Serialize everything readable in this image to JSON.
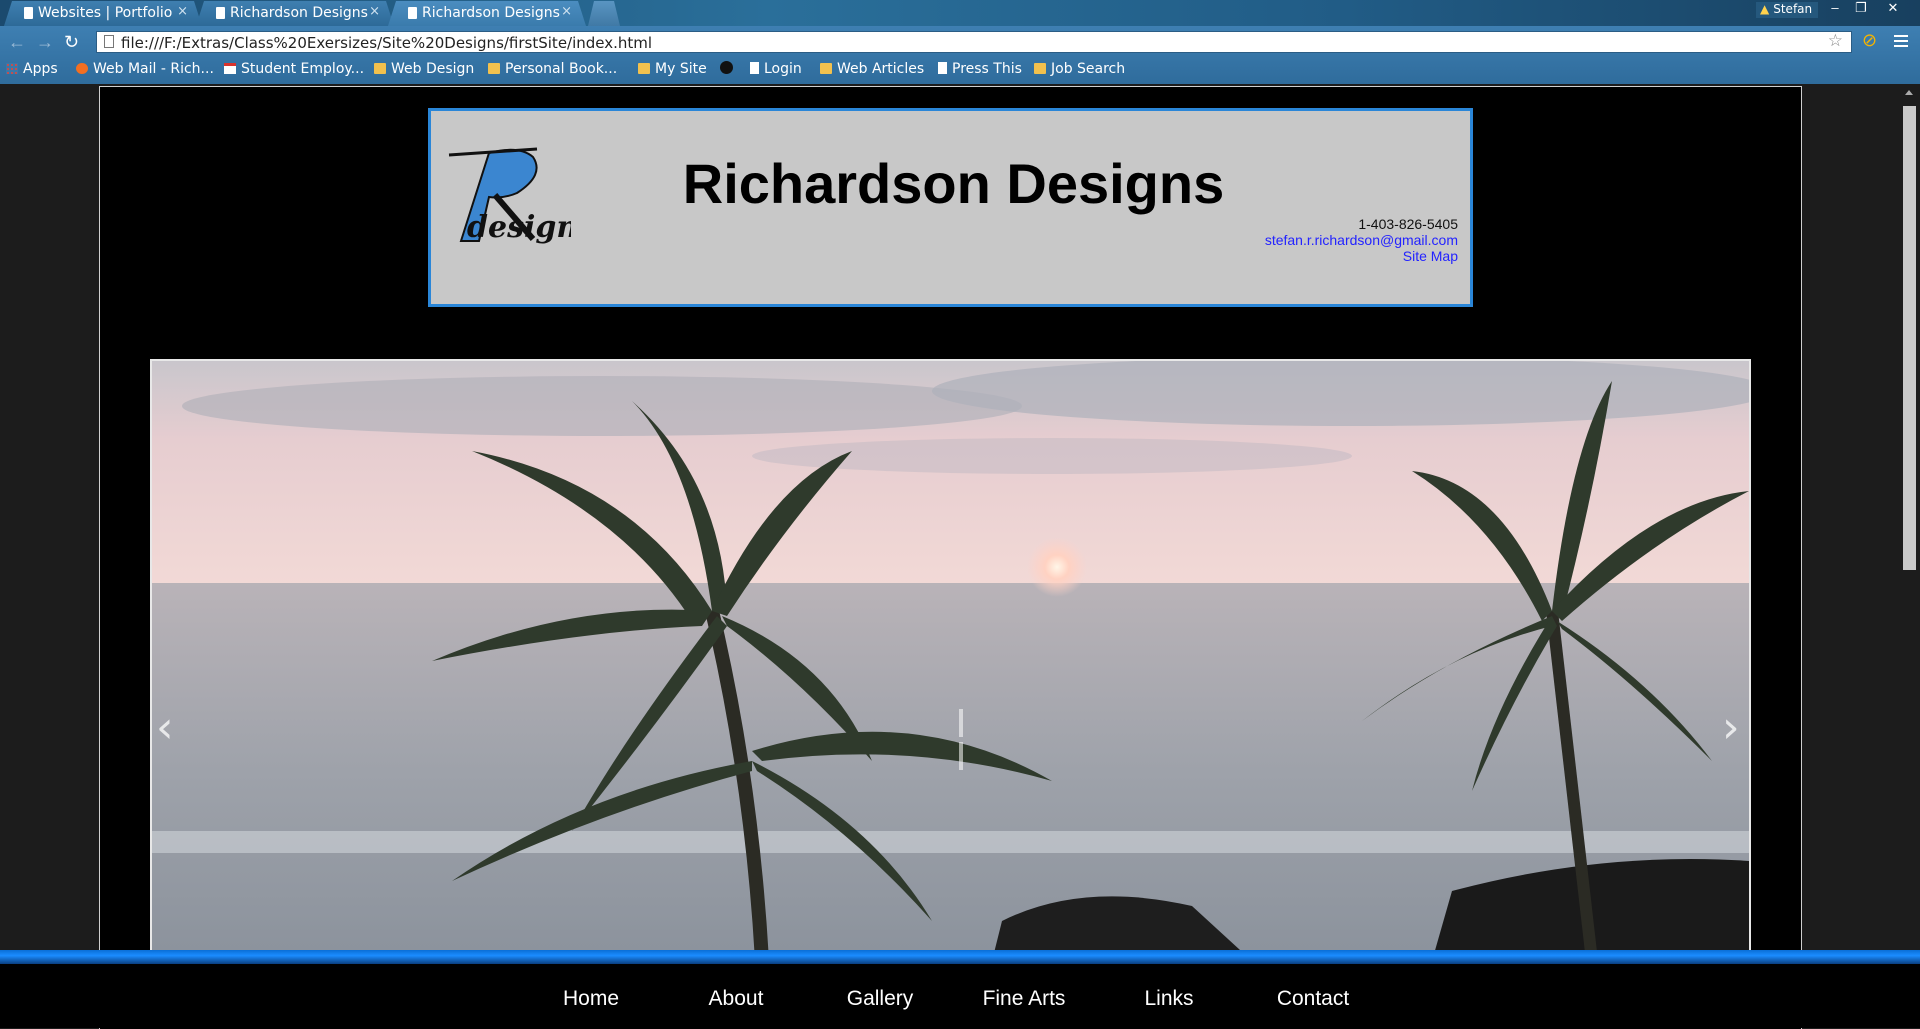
{
  "browser": {
    "tabs": [
      {
        "title": "Websites | Portfolio"
      },
      {
        "title": "Richardson Designs"
      },
      {
        "title": "Richardson Designs"
      }
    ],
    "profile_name": "Stefan",
    "window_controls": {
      "minimize": "–",
      "restore": "❐",
      "close": "✕"
    },
    "address": "file:///F:/Extras/Class%20Exersizes/Site%20Designs/firstSite/index.html",
    "bookmarks": [
      {
        "label": "Apps",
        "icon": "apps-icon"
      },
      {
        "label": "Web Mail - Rich...",
        "icon": "cpanel-icon"
      },
      {
        "label": "Student Employ...",
        "icon": "calendar-icon"
      },
      {
        "label": "Web Design",
        "icon": "folder-icon"
      },
      {
        "label": "Personal Book...",
        "icon": "folder-icon"
      },
      {
        "label": "My Site",
        "icon": "folder-icon"
      },
      {
        "label": "",
        "icon": "github-icon"
      },
      {
        "label": "Login",
        "icon": "page-icon"
      },
      {
        "label": "Web Articles",
        "icon": "folder-icon"
      },
      {
        "label": "Press This",
        "icon": "page-icon"
      },
      {
        "label": "Job Search",
        "icon": "folder-icon"
      }
    ]
  },
  "site": {
    "title": "Richardson Designs",
    "logo_text": "designs",
    "logo_letter": "R",
    "phone": "1-403-826-5405",
    "email": "stefan.r.richardson@gmail.com",
    "sitemap": "Site Map",
    "accent_color": "#2a86d8"
  },
  "slider": {
    "prev": "‹",
    "next": "›"
  },
  "nav": [
    {
      "label": "Home"
    },
    {
      "label": "About"
    },
    {
      "label": "Gallery"
    },
    {
      "label": "Fine Arts"
    },
    {
      "label": "Links"
    },
    {
      "label": "Contact"
    }
  ]
}
